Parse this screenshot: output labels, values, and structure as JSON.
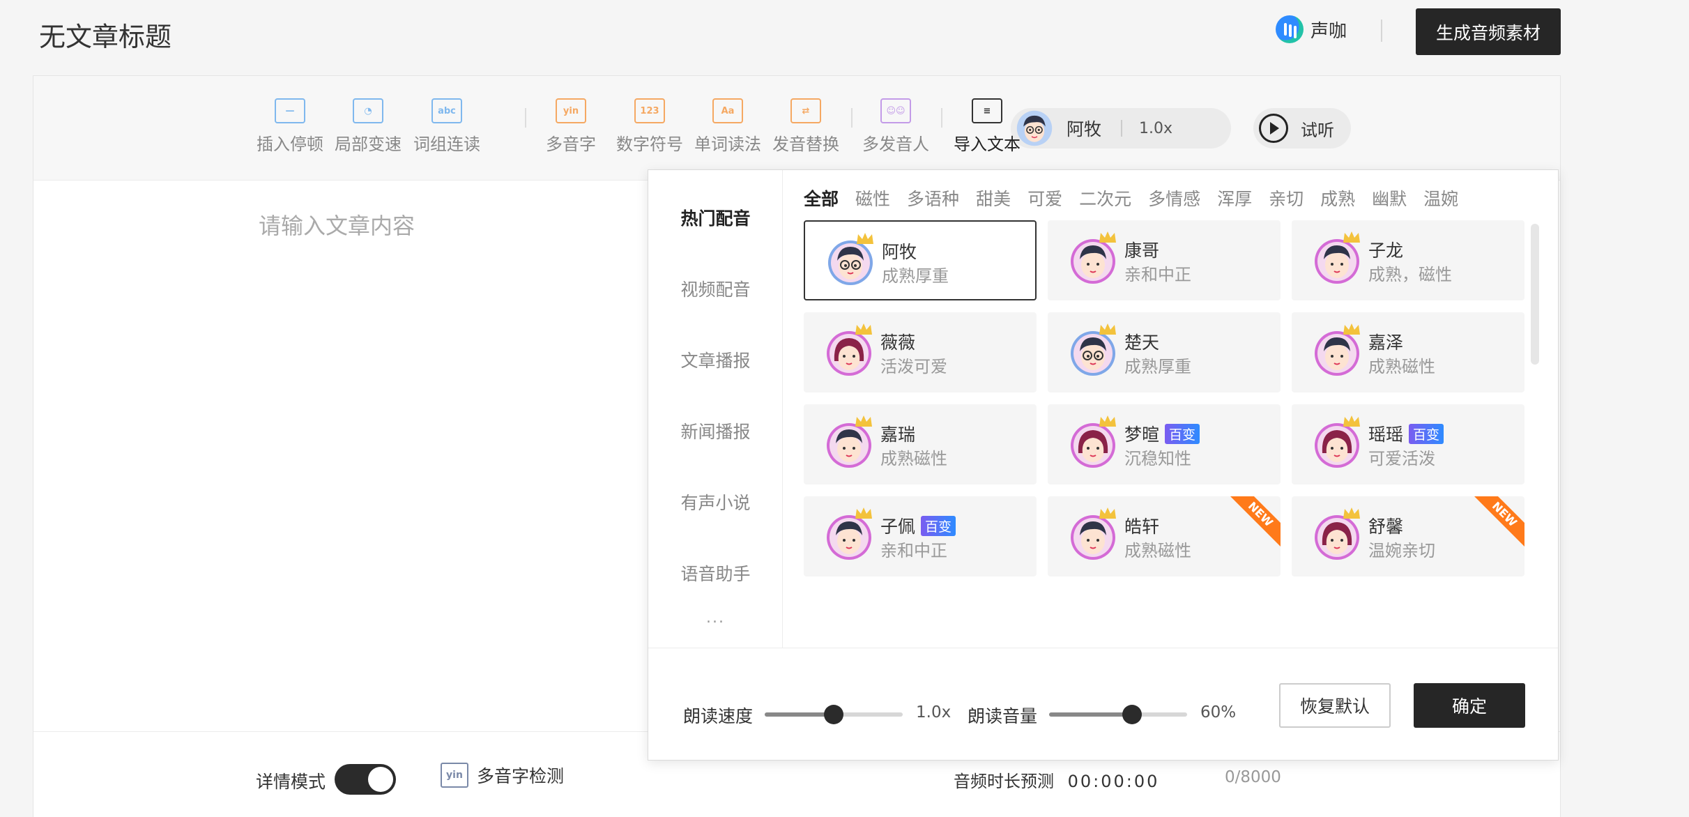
{
  "header": {
    "title": "无文章标题",
    "brand_name": "声咖",
    "generate_label": "生成音频素材"
  },
  "toolbar": {
    "tools": [
      {
        "label": "插入停顿",
        "icon": "pause-insert-icon",
        "glyph": "—",
        "color": "#7fb8ee"
      },
      {
        "label": "局部变速",
        "icon": "speedometer-icon",
        "glyph": "◔",
        "color": "#7fb8ee"
      },
      {
        "label": "词组连读",
        "icon": "abc-icon",
        "glyph": "abc",
        "color": "#7fb8ee"
      },
      {
        "label": "多音字",
        "icon": "pinyin-icon",
        "glyph": "yin",
        "color": "#f5a862"
      },
      {
        "label": "数字符号",
        "icon": "number-icon",
        "glyph": "123",
        "color": "#f5a862"
      },
      {
        "label": "单词读法",
        "icon": "word-reading-icon",
        "glyph": "Aa",
        "color": "#f5a862"
      },
      {
        "label": "发音替换",
        "icon": "replace-icon",
        "glyph": "⇄",
        "color": "#f5a862"
      },
      {
        "label": "多发音人",
        "icon": "multi-speaker-icon",
        "glyph": "☺☺",
        "color": "#c39be8"
      },
      {
        "label": "导入文本",
        "icon": "import-text-icon",
        "glyph": "≡",
        "color": "#333333"
      }
    ],
    "current_voice": "阿牧",
    "current_speed": "1.0x",
    "try_label": "试听"
  },
  "editor": {
    "placeholder": "请输入文章内容",
    "detail_mode_label": "详情模式",
    "detail_mode_on": true,
    "poly_check_label": "多音字检测",
    "duration_label": "音频时长预测",
    "duration_value": "00:00:00",
    "char_count": "0/8000"
  },
  "picker": {
    "categories": [
      "热门配音",
      "视频配音",
      "文章播报",
      "新闻播报",
      "有声小说",
      "语音助手"
    ],
    "active_category": "热门配音",
    "more": "...",
    "filters": [
      "全部",
      "磁性",
      "多语种",
      "甜美",
      "可爱",
      "二次元",
      "多情感",
      "浑厚",
      "亲切",
      "成熟",
      "幽默",
      "温婉"
    ],
    "active_filter": "全部",
    "voices": [
      {
        "name": "阿牧",
        "desc": "成熟厚重",
        "gender": "male-glasses",
        "badge": "",
        "new": false,
        "selected": true
      },
      {
        "name": "康哥",
        "desc": "亲和中正",
        "gender": "male",
        "badge": "",
        "new": false,
        "selected": false
      },
      {
        "name": "子龙",
        "desc": "成熟，磁性",
        "gender": "male",
        "badge": "",
        "new": false,
        "selected": false
      },
      {
        "name": "薇薇",
        "desc": "活泼可爱",
        "gender": "female",
        "badge": "",
        "new": false,
        "selected": false
      },
      {
        "name": "楚天",
        "desc": "成熟厚重",
        "gender": "male-glasses",
        "badge": "",
        "new": false,
        "selected": false
      },
      {
        "name": "嘉泽",
        "desc": "成熟磁性",
        "gender": "male",
        "badge": "",
        "new": false,
        "selected": false
      },
      {
        "name": "嘉瑞",
        "desc": "成熟磁性",
        "gender": "male",
        "badge": "",
        "new": false,
        "selected": false
      },
      {
        "name": "梦暄",
        "desc": "沉稳知性",
        "gender": "female",
        "badge": "百变",
        "new": false,
        "selected": false
      },
      {
        "name": "瑶瑶",
        "desc": "可爱活泼",
        "gender": "female",
        "badge": "百变",
        "new": false,
        "selected": false
      },
      {
        "name": "子佩",
        "desc": "亲和中正",
        "gender": "male",
        "badge": "百变",
        "new": false,
        "selected": false
      },
      {
        "name": "皓轩",
        "desc": "成熟磁性",
        "gender": "male",
        "badge": "",
        "new": true,
        "selected": false
      },
      {
        "name": "舒馨",
        "desc": "温婉亲切",
        "gender": "female",
        "badge": "",
        "new": true,
        "selected": false
      }
    ],
    "new_label": "NEW",
    "speed_label": "朗读速度",
    "speed_value": "1.0x",
    "speed_fraction": 0.5,
    "volume_label": "朗读音量",
    "volume_value": "60%",
    "volume_fraction": 0.6,
    "reset_label": "恢复默认",
    "confirm_label": "确定"
  }
}
